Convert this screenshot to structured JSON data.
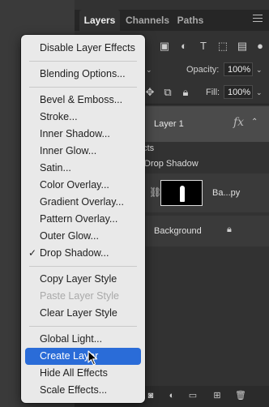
{
  "layers_panel": {
    "tabs": [
      {
        "label": "Layers"
      },
      {
        "label": "Channels"
      },
      {
        "label": "Paths"
      }
    ],
    "opacity_label": "Opacity:",
    "opacity_value": "100%",
    "fill_label": "Fill:",
    "fill_value": "100%",
    "layers": {
      "layer1_name": "Layer 1",
      "fx_label": "fx",
      "effects_label": "ects",
      "drop_shadow_label": "Drop Shadow",
      "bg_copy_name": "Ba...py",
      "background_name": "Background"
    }
  },
  "context_menu": {
    "items": [
      {
        "label": "Disable Layer Effects"
      },
      {
        "label": "Blending Options..."
      },
      {
        "label": "Bevel & Emboss..."
      },
      {
        "label": "Stroke..."
      },
      {
        "label": "Inner Shadow..."
      },
      {
        "label": "Inner Glow..."
      },
      {
        "label": "Satin..."
      },
      {
        "label": "Color Overlay..."
      },
      {
        "label": "Gradient Overlay..."
      },
      {
        "label": "Pattern Overlay..."
      },
      {
        "label": "Outer Glow..."
      },
      {
        "label": "Drop Shadow...",
        "checked": true
      },
      {
        "label": "Copy Layer Style"
      },
      {
        "label": "Paste Layer Style",
        "disabled": true
      },
      {
        "label": "Clear Layer Style"
      },
      {
        "label": "Global Light..."
      },
      {
        "label": "Create Layer",
        "highlighted": true
      },
      {
        "label": "Hide All Effects"
      },
      {
        "label": "Scale Effects..."
      }
    ],
    "check_mark": "✓"
  },
  "colors": {
    "highlight": "#2a6cd8",
    "menu_bg": "#e9e9e9",
    "panel_bg": "#323232"
  }
}
